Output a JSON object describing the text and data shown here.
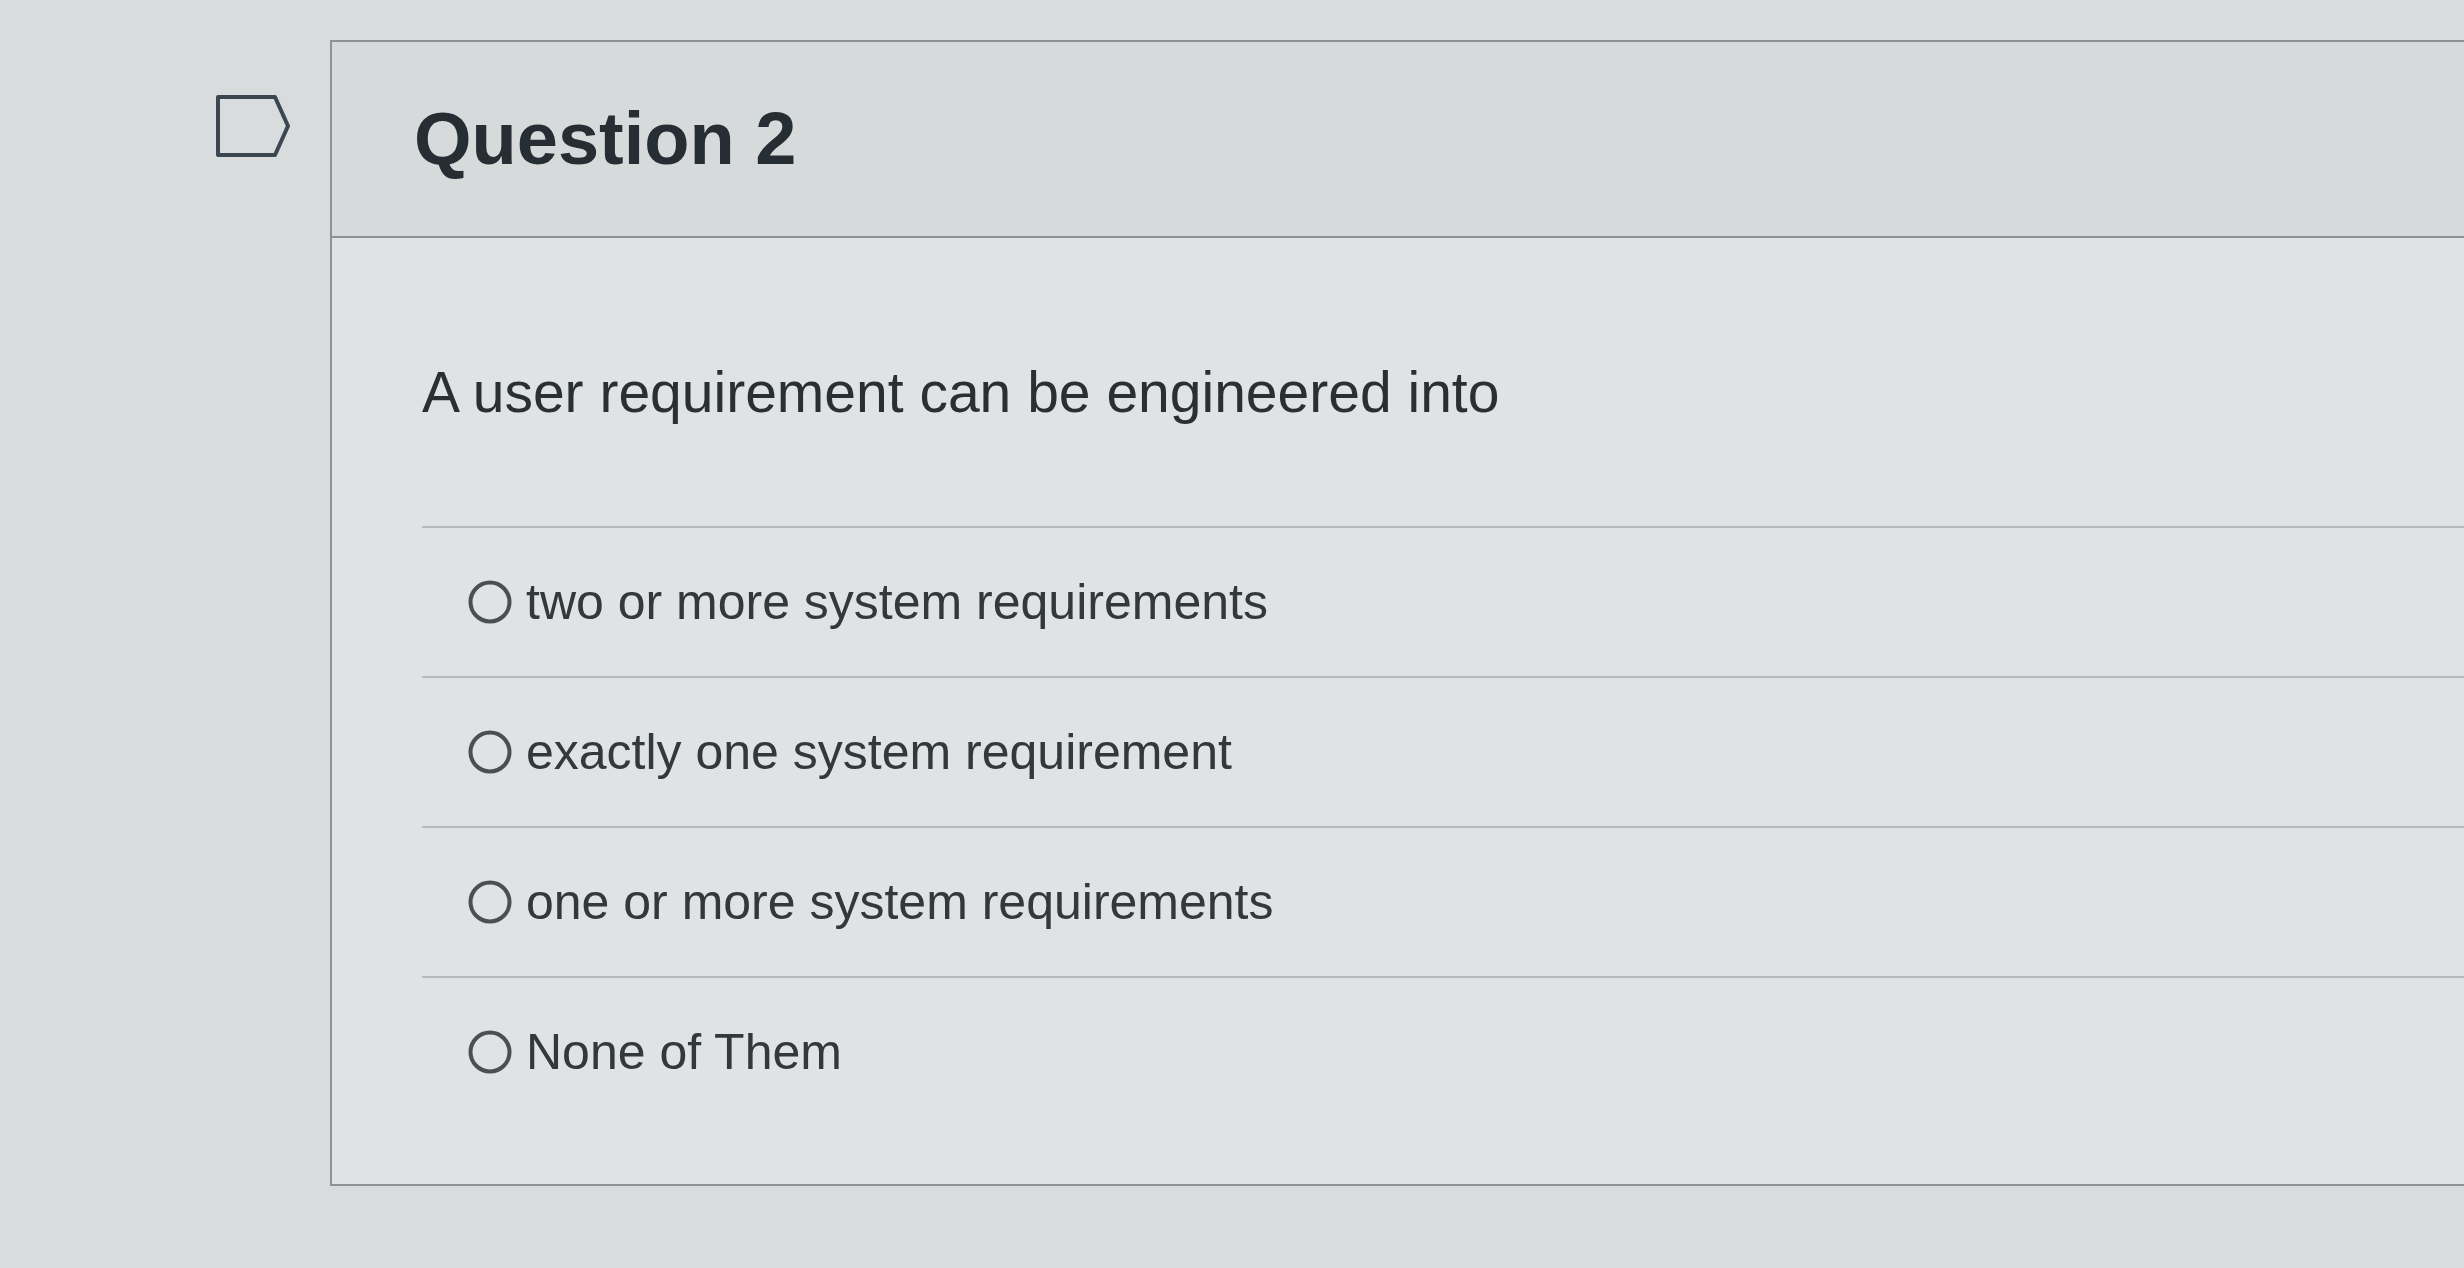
{
  "question": {
    "flagged": false,
    "title": "Question 2",
    "text": "A user requirement can be engineered into"
  },
  "answers": [
    {
      "label": "two or more system requirements",
      "selected": false
    },
    {
      "label": "exactly one system requirement",
      "selected": false
    },
    {
      "label": "one or more system requirements",
      "selected": false
    },
    {
      "label": "None of Them",
      "selected": false
    }
  ]
}
